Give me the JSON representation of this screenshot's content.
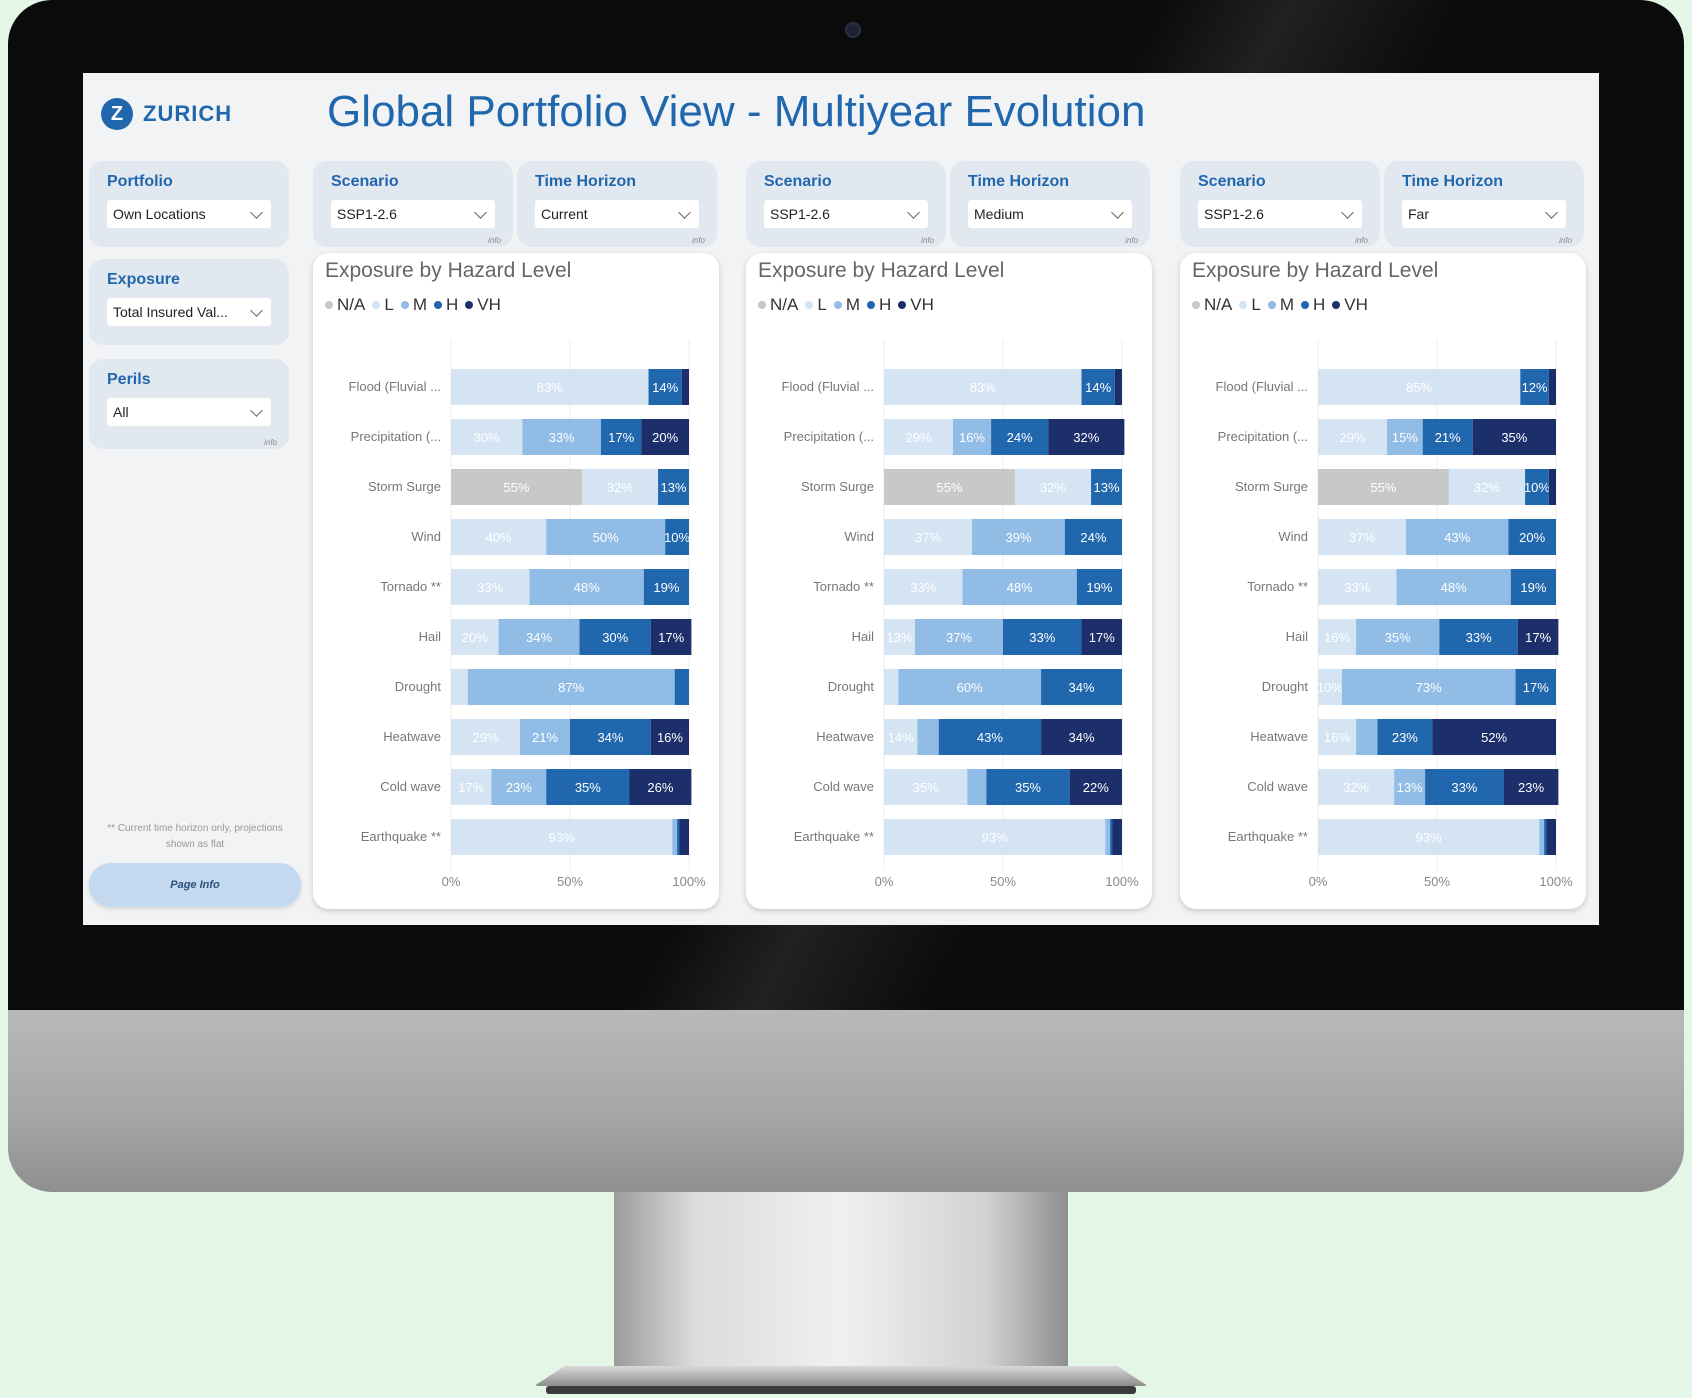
{
  "header": {
    "logo_text": "ZURICH",
    "logo_mark": "Z",
    "title": "Global Portfolio View - Multiyear Evolution"
  },
  "filters": {
    "portfolio": {
      "label": "Portfolio",
      "value": "Own Locations"
    },
    "exposure": {
      "label": "Exposure",
      "value": "Total Insured Val..."
    },
    "perils": {
      "label": "Perils",
      "value": "All",
      "info": "info"
    }
  },
  "panels": [
    {
      "scenario_label": "Scenario",
      "scenario_value": "SSP1-2.6",
      "horizon_label": "Time Horizon",
      "horizon_value": "Current",
      "info": "info"
    },
    {
      "scenario_label": "Scenario",
      "scenario_value": "SSP1-2.6",
      "horizon_label": "Time Horizon",
      "horizon_value": "Medium",
      "info": "info"
    },
    {
      "scenario_label": "Scenario",
      "scenario_value": "SSP1-2.6",
      "horizon_label": "Time Horizon",
      "horizon_value": "Far",
      "info": "info"
    }
  ],
  "footnote": "** Current time horizon only, projections shown as flat",
  "page_info_label": "Page Info",
  "colors": {
    "N/A": "#c8c8c8",
    "L": "#d4e4f3",
    "M": "#90bce6",
    "H": "#2167ae",
    "VH": "#1c2f6b",
    "brand": "#2167ae"
  },
  "chart_data": [
    {
      "type": "bar",
      "stacked": "100%",
      "orientation": "horizontal",
      "title": "Exposure by Hazard Level",
      "legend": [
        "N/A",
        "L",
        "M",
        "H",
        "VH"
      ],
      "legend_position": "top-left",
      "categories": [
        "Flood (Fluvial ...",
        "Precipitation (...",
        "Storm Surge",
        "Wind",
        "Tornado **",
        "Hail",
        "Drought",
        "Heatwave",
        "Cold wave",
        "Earthquake **"
      ],
      "xticks": [
        "0%",
        "50%",
        "100%"
      ],
      "xlim": [
        0,
        100
      ],
      "series": [
        {
          "name": "N/A",
          "values": [
            0,
            0,
            55,
            0,
            0,
            0,
            0,
            0,
            0,
            0
          ]
        },
        {
          "name": "L",
          "values": [
            83,
            30,
            32,
            40,
            33,
            20,
            7,
            29,
            17,
            93
          ]
        },
        {
          "name": "M",
          "values": [
            0,
            33,
            0,
            50,
            48,
            34,
            87,
            21,
            23,
            2
          ]
        },
        {
          "name": "H",
          "values": [
            14,
            17,
            13,
            10,
            19,
            30,
            6,
            34,
            35,
            1
          ]
        },
        {
          "name": "VH",
          "values": [
            3,
            20,
            0,
            0,
            0,
            17,
            0,
            16,
            26,
            4
          ]
        }
      ]
    },
    {
      "type": "bar",
      "stacked": "100%",
      "orientation": "horizontal",
      "title": "Exposure by Hazard Level",
      "legend": [
        "N/A",
        "L",
        "M",
        "H",
        "VH"
      ],
      "legend_position": "top-left",
      "categories": [
        "Flood (Fluvial ...",
        "Precipitation (...",
        "Storm Surge",
        "Wind",
        "Tornado **",
        "Hail",
        "Drought",
        "Heatwave",
        "Cold wave",
        "Earthquake **"
      ],
      "xticks": [
        "0%",
        "50%",
        "100%"
      ],
      "xlim": [
        0,
        100
      ],
      "series": [
        {
          "name": "N/A",
          "values": [
            0,
            0,
            55,
            0,
            0,
            0,
            0,
            0,
            0,
            0
          ]
        },
        {
          "name": "L",
          "values": [
            83,
            29,
            32,
            37,
            33,
            13,
            6,
            14,
            35,
            93
          ]
        },
        {
          "name": "M",
          "values": [
            0,
            16,
            0,
            39,
            48,
            37,
            60,
            9,
            8,
            2
          ]
        },
        {
          "name": "H",
          "values": [
            14,
            24,
            13,
            24,
            19,
            33,
            34,
            43,
            35,
            1
          ]
        },
        {
          "name": "VH",
          "values": [
            3,
            32,
            0,
            0,
            0,
            17,
            0,
            34,
            22,
            4
          ]
        }
      ]
    },
    {
      "type": "bar",
      "stacked": "100%",
      "orientation": "horizontal",
      "title": "Exposure by Hazard Level",
      "legend": [
        "N/A",
        "L",
        "M",
        "H",
        "VH"
      ],
      "legend_position": "top-left",
      "categories": [
        "Flood (Fluvial ...",
        "Precipitation (...",
        "Storm Surge",
        "Wind",
        "Tornado **",
        "Hail",
        "Drought",
        "Heatwave",
        "Cold wave",
        "Earthquake **"
      ],
      "xticks": [
        "0%",
        "50%",
        "100%"
      ],
      "xlim": [
        0,
        100
      ],
      "series": [
        {
          "name": "N/A",
          "values": [
            0,
            0,
            55,
            0,
            0,
            0,
            0,
            0,
            0,
            0
          ]
        },
        {
          "name": "L",
          "values": [
            85,
            29,
            32,
            37,
            33,
            16,
            10,
            16,
            32,
            93
          ]
        },
        {
          "name": "M",
          "values": [
            0,
            15,
            0,
            43,
            48,
            35,
            73,
            9,
            13,
            2
          ]
        },
        {
          "name": "H",
          "values": [
            12,
            21,
            10,
            20,
            19,
            33,
            17,
            23,
            33,
            1
          ]
        },
        {
          "name": "VH",
          "values": [
            3,
            35,
            3,
            0,
            0,
            17,
            0,
            52,
            23,
            4
          ]
        }
      ]
    }
  ]
}
